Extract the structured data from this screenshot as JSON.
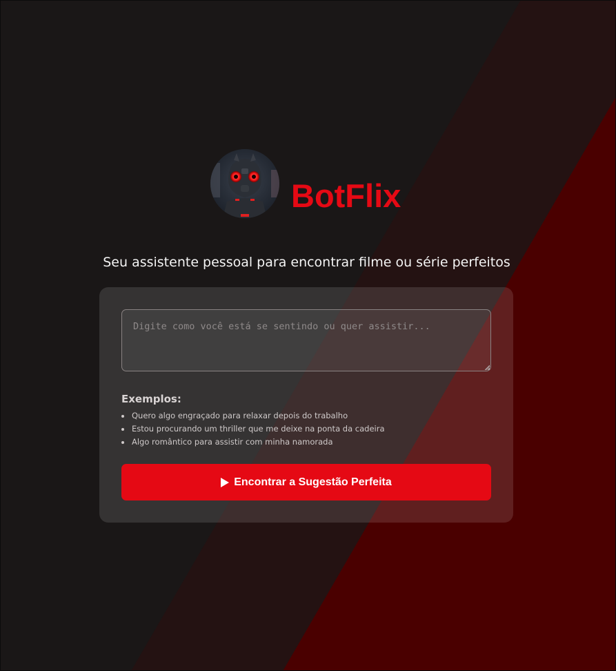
{
  "app": {
    "name": "BotFlix",
    "tagline": "Seu assistente pessoal para encontrar filme ou série perfeitos",
    "avatar_icon": "robot-avatar-icon"
  },
  "form": {
    "input_placeholder": "Digite como você está se sentindo ou quer assistir...",
    "input_value": "",
    "examples_title": "Exemplos:",
    "examples": [
      "Quero algo engraçado para relaxar depois do trabalho",
      "Estou procurando um thriller que me deixe na ponta da cadeira",
      "Algo romântico para assistir com minha namorada"
    ],
    "submit_label": "Encontrar a Sugestão Perfeita",
    "submit_icon": "play-icon"
  },
  "colors": {
    "brand": "#e50914",
    "background_dark": "#1a1717",
    "background_red": "#4a0000"
  }
}
